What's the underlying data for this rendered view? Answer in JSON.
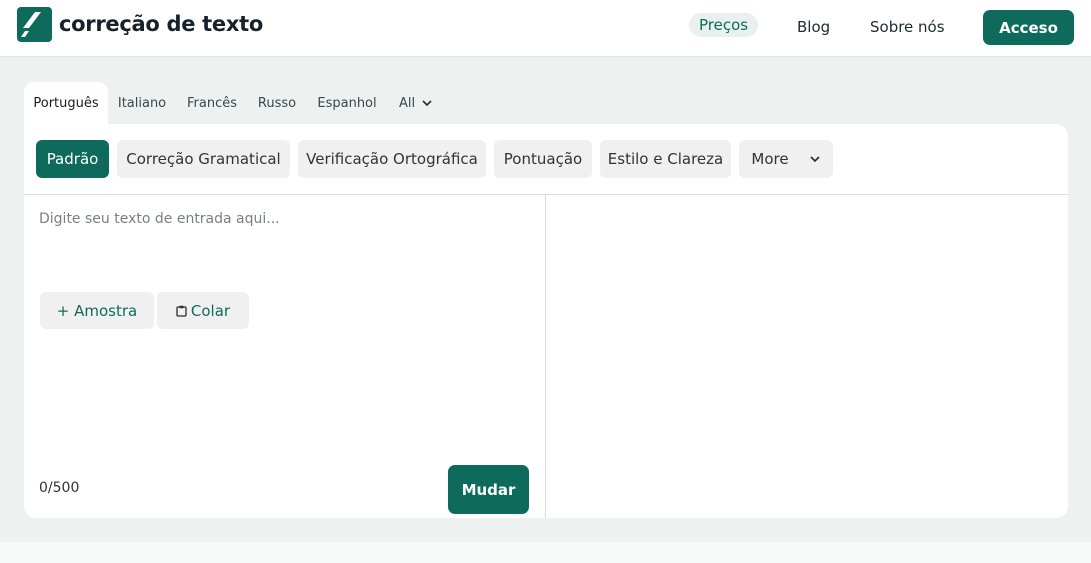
{
  "header": {
    "logo_text": "correção de texto",
    "nav": [
      {
        "label": "Preços",
        "active": true
      },
      {
        "label": "Blog",
        "active": false
      },
      {
        "label": "Sobre nós",
        "active": false
      }
    ],
    "login_label": "Acceso"
  },
  "languages": {
    "tabs": [
      "Português",
      "Italiano",
      "Francês",
      "Russo",
      "Espanhol",
      "All"
    ],
    "selected": "Português"
  },
  "modes": {
    "items": [
      "Padrão",
      "Correção Gramatical",
      "Verificação Ortográfica",
      "Pontuação",
      "Estilo e Clareza"
    ],
    "more_label": "More",
    "selected": "Padrão"
  },
  "editor": {
    "placeholder": "Digite seu texto de entrada aqui...",
    "sample_label": "+ Amostra",
    "paste_label": "Colar",
    "char_count": "0/500",
    "submit_label": "Mudar"
  },
  "colors": {
    "brand": "#0e6b5c",
    "page_bg": "#edf2f1"
  }
}
